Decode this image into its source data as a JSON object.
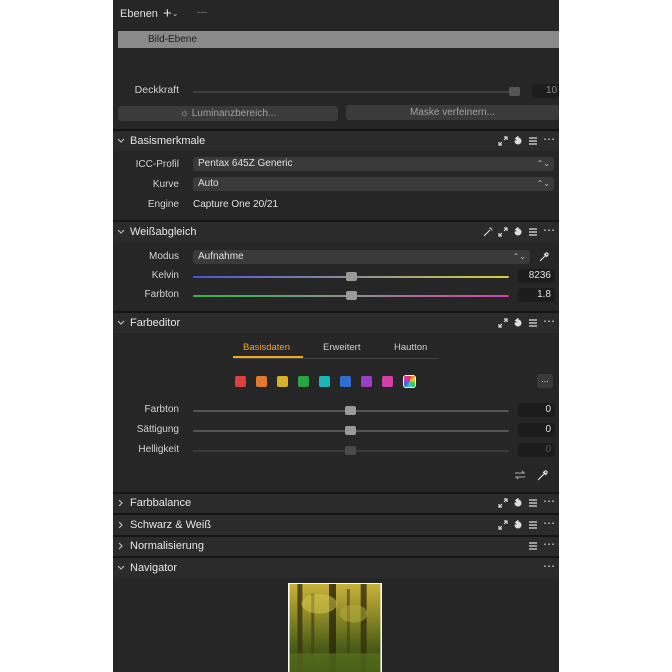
{
  "layers": {
    "title": "Ebenen",
    "add_symbol": "+",
    "remove_symbol": "—",
    "selected_layer": "Bild-Ebene",
    "opacity_label": "Deckkraft",
    "opacity_value": "10",
    "luminance_button": "Luminanzbereich...",
    "refine_mask_button": "Maske verfeinern..."
  },
  "basic": {
    "title": "Basismerkmale",
    "icc_label": "ICC-Profil",
    "icc_value": "Pentax 645Z Generic",
    "curve_label": "Kurve",
    "curve_value": "Auto",
    "engine_label": "Engine",
    "engine_value": "Capture One 20/21"
  },
  "white_balance": {
    "title": "Weißabgleich",
    "mode_label": "Modus",
    "mode_value": "Aufnahme",
    "kelvin_label": "Kelvin",
    "kelvin_value": "8236",
    "kelvin_level": 0.5,
    "tint_label": "Farbton",
    "tint_value": "1.8",
    "tint_level": 0.5
  },
  "color_editor": {
    "title": "Farbeditor",
    "tabs": [
      "Basisdaten",
      "Erweitert",
      "Hautton"
    ],
    "active_tab": 0,
    "more_symbol": "...",
    "swatches": [
      "#d9413f",
      "#e17a2c",
      "#d8b12c",
      "#28a443",
      "#19b6b6",
      "#2f6fd4",
      "#9a3fc4",
      "#d23fa6"
    ],
    "hue_label": "Farbton",
    "hue_value": "0",
    "saturation_label": "Sättigung",
    "saturation_value": "0",
    "lightness_label": "Helligkeit",
    "lightness_value": "0"
  },
  "collapsed": {
    "color_balance": "Farbbalance",
    "black_white": "Schwarz & Weiß",
    "normalization": "Normalisierung"
  },
  "navigator": {
    "title": "Navigator"
  },
  "colors": {
    "accent": "#f5a623",
    "panel_bg": "#262626",
    "header_bg": "#2b2b2b"
  }
}
